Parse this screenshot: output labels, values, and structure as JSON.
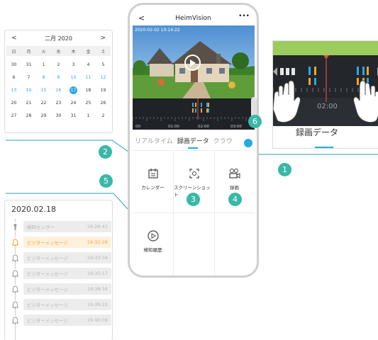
{
  "calendar": {
    "title": "二月 2020",
    "prev": "<",
    "next": ">",
    "weekdays": [
      "日",
      "月",
      "火",
      "水",
      "木",
      "金",
      "土"
    ],
    "days": [
      {
        "d": "30",
        "c": ""
      },
      {
        "d": "31",
        "c": ""
      },
      {
        "d": "1",
        "c": ""
      },
      {
        "d": "2",
        "c": ""
      },
      {
        "d": "3",
        "c": ""
      },
      {
        "d": "4",
        "c": ""
      },
      {
        "d": "5",
        "c": ""
      },
      {
        "d": "6",
        "c": ""
      },
      {
        "d": "7",
        "c": ""
      },
      {
        "d": "8",
        "c": "blue"
      },
      {
        "d": "9",
        "c": "blue"
      },
      {
        "d": "10",
        "c": "blue"
      },
      {
        "d": "11",
        "c": "blue"
      },
      {
        "d": "12",
        "c": "blue"
      },
      {
        "d": "13",
        "c": "blue"
      },
      {
        "d": "14",
        "c": "blue"
      },
      {
        "d": "15",
        "c": "blue"
      },
      {
        "d": "16",
        "c": "blue"
      },
      {
        "d": "17",
        "c": "sel"
      },
      {
        "d": "18",
        "c": ""
      },
      {
        "d": "19",
        "c": ""
      },
      {
        "d": "20",
        "c": ""
      },
      {
        "d": "21",
        "c": ""
      },
      {
        "d": "22",
        "c": ""
      },
      {
        "d": "23",
        "c": ""
      },
      {
        "d": "24",
        "c": ""
      },
      {
        "d": "25",
        "c": ""
      },
      {
        "d": "26",
        "c": ""
      },
      {
        "d": "27",
        "c": ""
      },
      {
        "d": "28",
        "c": ""
      },
      {
        "d": "29",
        "c": ""
      },
      {
        "d": "30",
        "c": ""
      },
      {
        "d": "31",
        "c": ""
      },
      {
        "d": "1",
        "c": ""
      },
      {
        "d": "2",
        "c": ""
      }
    ]
  },
  "events": {
    "date": "2020.02.18",
    "items": [
      {
        "label": "検知センサー",
        "time": "19:26:41",
        "icon": "sensor-icon",
        "active": false
      },
      {
        "label": "ビジターメッセージ",
        "time": "19:32:29",
        "icon": "bell-icon",
        "active": true
      },
      {
        "label": "ビジターメッセージ",
        "time": "19:33:34",
        "icon": "bell-icon",
        "active": false
      },
      {
        "label": "ビジターメッセージ",
        "time": "19:35:17",
        "icon": "bell-icon",
        "active": false
      },
      {
        "label": "ビジターメッセージ",
        "time": "19:38:34",
        "icon": "bell-icon",
        "active": false
      },
      {
        "label": "ビジターメッセージ",
        "time": "19:39:22",
        "icon": "bell-icon",
        "active": false
      },
      {
        "label": "ビジターメッセージ",
        "time": "19:40:09",
        "icon": "bell-icon",
        "active": false
      }
    ]
  },
  "phone": {
    "title": "HeimVision",
    "back": "<",
    "more": "•••",
    "timestamp": "2020-02-02  10:14:22",
    "timeline_labels": [
      "00",
      "01:00",
      "02:00",
      "03:00"
    ],
    "tabs": [
      "リアルタイム",
      "録画データ",
      "クラウ"
    ],
    "grid": {
      "calendar": "カレンダー",
      "screenshot": "スクリーンショット",
      "record": "録画",
      "history": "検知履歴"
    }
  },
  "badges": [
    "1",
    "2",
    "3",
    "4",
    "5",
    "6"
  ],
  "zoom": {
    "label": "録画データ",
    "time": "02:00"
  },
  "colors": {
    "accent": "#27a9e1",
    "badge": "#3ab8a7",
    "highlight": "#f0a430",
    "marker": "#e04848"
  }
}
